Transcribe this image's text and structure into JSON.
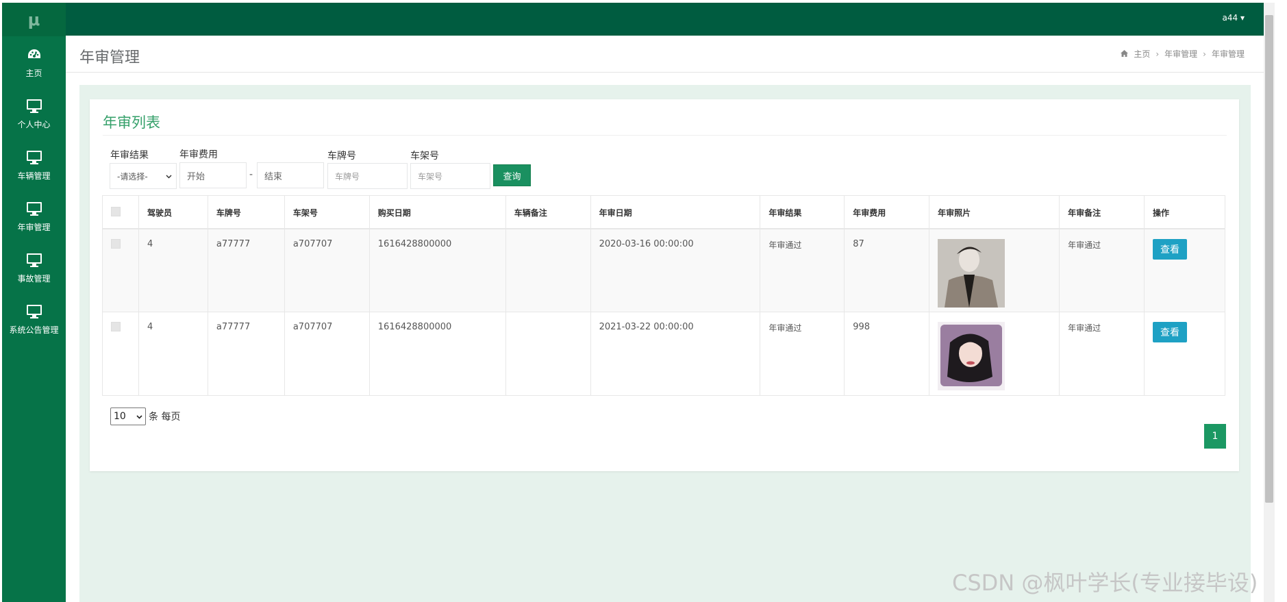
{
  "sidebar": {
    "logo": "μ",
    "items": [
      {
        "label": "主页",
        "icon": "dashboard-icon"
      },
      {
        "label": "个人中心",
        "icon": "monitor-icon"
      },
      {
        "label": "车辆管理",
        "icon": "monitor-icon"
      },
      {
        "label": "年审管理",
        "icon": "monitor-icon"
      },
      {
        "label": "事故管理",
        "icon": "monitor-icon"
      },
      {
        "label": "系统公告管理",
        "icon": "monitor-icon"
      }
    ]
  },
  "topbar": {
    "user": "a44 ▾"
  },
  "header": {
    "title": "年审管理",
    "breadcrumb": [
      "主页",
      "年审管理",
      "年审管理"
    ]
  },
  "panel": {
    "title": "年审列表",
    "filters": {
      "result_label": "年审结果",
      "result_value": "-请选择-",
      "fee_label": "年审费用",
      "fee_start": "开始",
      "dash": "-",
      "fee_end": "结束",
      "plate_label": "车牌号",
      "plate_placeholder": "车牌号",
      "vin_label": "车架号",
      "vin_placeholder": "车架号",
      "query_button": "查询"
    },
    "table": {
      "headers": [
        "驾驶员",
        "车牌号",
        "车架号",
        "购买日期",
        "车辆备注",
        "年审日期",
        "年审结果",
        "年审费用",
        "年审照片",
        "年审备注",
        "操作"
      ],
      "rows": [
        {
          "driver": "4",
          "plate": "a77777",
          "vin": "a707707",
          "purchase": "1616428800000",
          "remark": "",
          "date": "2020-03-16 00:00:00",
          "result": "年审通过",
          "fee": "87",
          "note": "年审通过",
          "action": "查看"
        },
        {
          "driver": "4",
          "plate": "a77777",
          "vin": "a707707",
          "purchase": "1616428800000",
          "remark": "",
          "date": "2021-03-22 00:00:00",
          "result": "年审通过",
          "fee": "998",
          "note": "年审通过",
          "action": "查看"
        }
      ]
    },
    "pagination": {
      "page_size": "10",
      "page_size_suffix": "条 每页",
      "current_page": "1"
    }
  },
  "watermark": "CSDN @枫叶学长(专业接毕设)",
  "colors": {
    "sidebar": "#067348",
    "topbar": "#005c40",
    "accent": "#35a06a",
    "view_button": "#1ea1c4"
  }
}
